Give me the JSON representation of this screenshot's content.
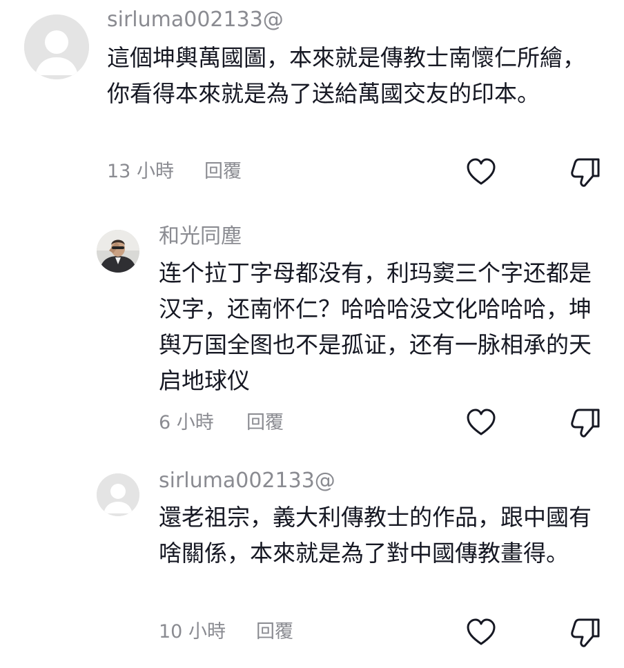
{
  "comments": [
    {
      "username": "sirluma002133@",
      "text": "這個坤輿萬國圖，本來就是傳教士南懷仁所繪，你看得本來就是為了送給萬國交友的印本。",
      "time": "13 小時",
      "reply_label": "回覆",
      "avatar_icon": "default-avatar-icon"
    },
    {
      "username": "和光同塵",
      "text": "连个拉丁字母都没有，利玛窦三个字还都是汉字，还南怀仁？哈哈哈没文化哈哈哈，坤舆万国全图也不是孤证，还有一脉相承的天启地球仪",
      "time": "6 小時",
      "reply_label": "回覆",
      "avatar_icon": "user-photo-avatar"
    },
    {
      "username": "sirluma002133@",
      "text": "還老祖宗，義大利傳教士的作品，跟中國有啥關係，本來就是為了對中國傳教畫得。",
      "time": "10 小時",
      "reply_label": "回覆",
      "avatar_icon": "default-avatar-icon"
    }
  ],
  "icons": {
    "like": "heart-outline-icon",
    "dislike": "thumbs-down-outline-icon"
  },
  "colors": {
    "text": "#161823",
    "secondary": "#8a8b91",
    "avatar_bg": "#e4e4e4"
  }
}
